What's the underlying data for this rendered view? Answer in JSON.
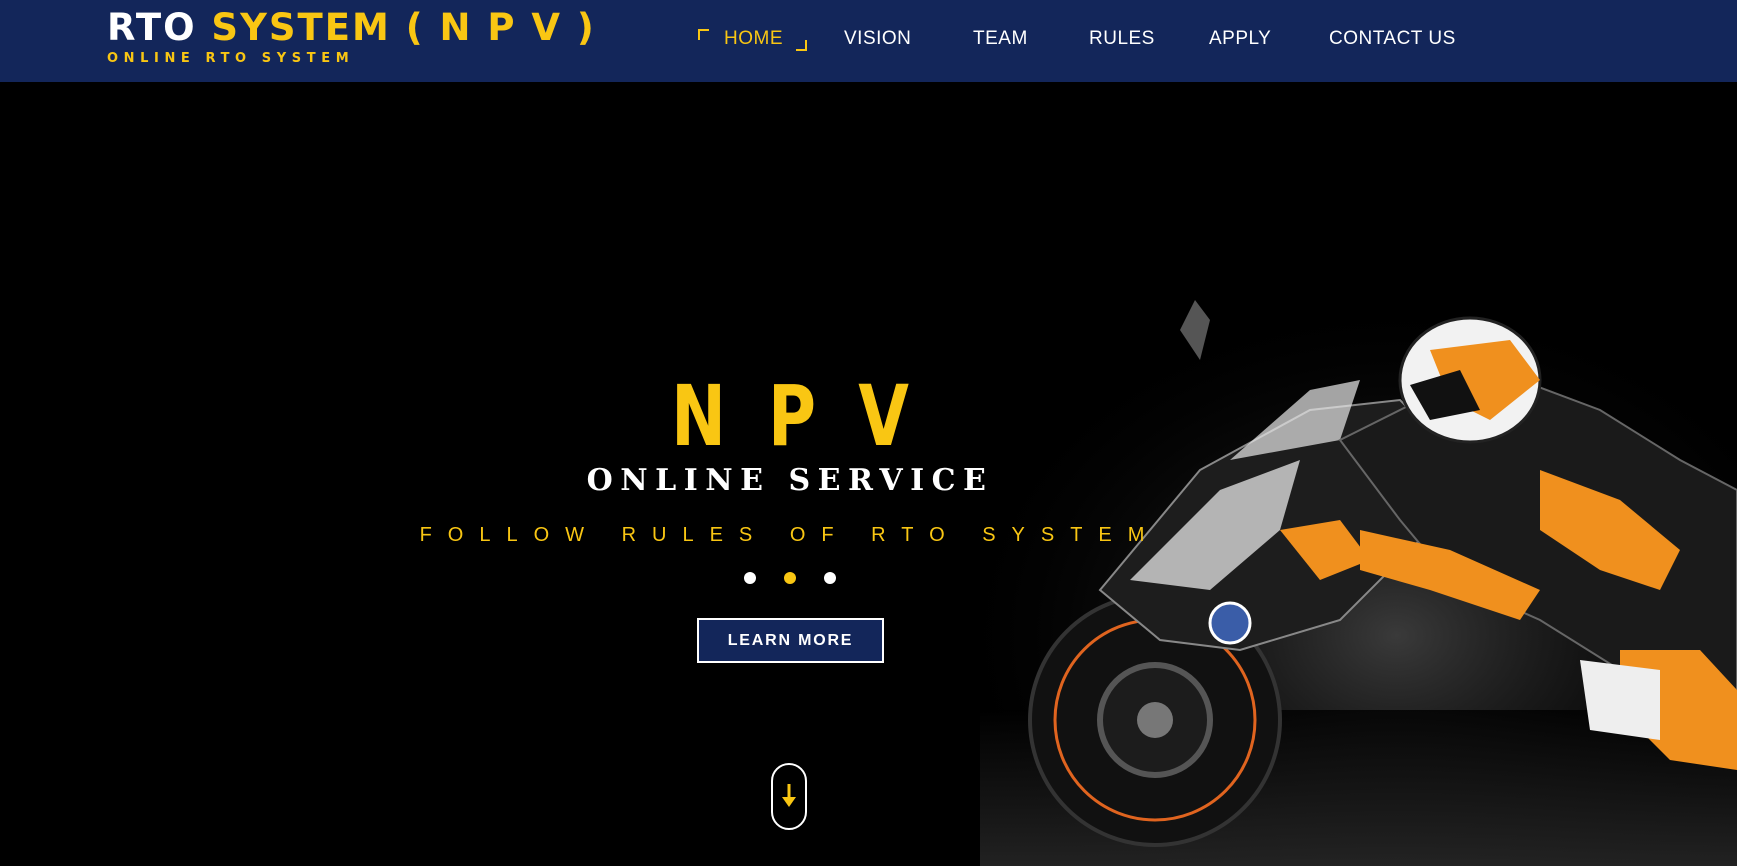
{
  "header": {
    "brand_part1": "RTO",
    "brand_part2": "SYSTEM ( N P V )",
    "brand_subtitle": "ONLINE RTO SYSTEM"
  },
  "nav": {
    "items": [
      {
        "label": "HOME",
        "active": true
      },
      {
        "label": "VISION",
        "active": false
      },
      {
        "label": "TEAM",
        "active": false
      },
      {
        "label": "RULES",
        "active": false
      },
      {
        "label": "APPLY",
        "active": false
      },
      {
        "label": "CONTACT US",
        "active": false
      }
    ]
  },
  "hero": {
    "title": "NPV",
    "subtitle": "ONLINE SERVICE",
    "tagline": "FOLLOW RULES OF RTO SYSTEM",
    "slides": 3,
    "active_slide": 2,
    "button_label": "LEARN MORE",
    "scroll_icon": "arrow-down-icon",
    "image_subject": "motorcycle-rider-image"
  },
  "colors": {
    "navbar": "#13265a",
    "accent": "#f9c613",
    "background": "#000000",
    "text": "#ffffff"
  }
}
